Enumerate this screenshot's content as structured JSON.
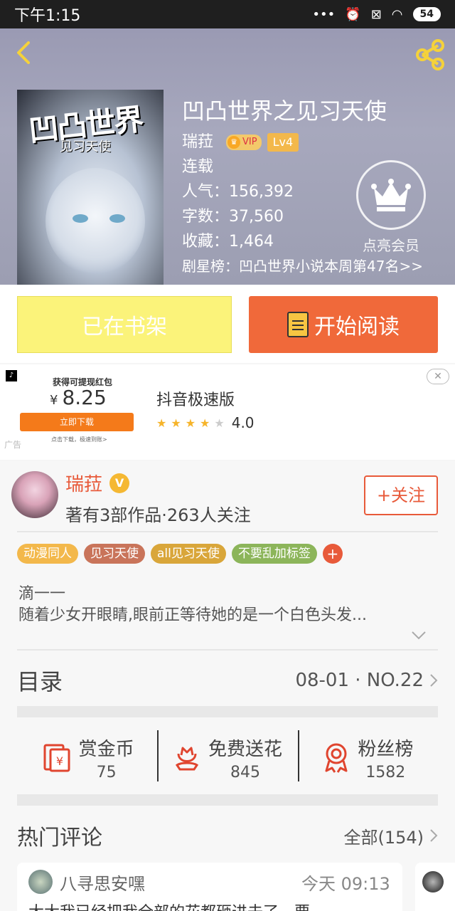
{
  "status_bar": {
    "time": "下午1:15",
    "battery": "54"
  },
  "book": {
    "title": "凹凸世界之见习天使",
    "cover_title": "凹凸世界",
    "cover_subtitle": "见习天使",
    "author": "瑞菈",
    "vip_label": "VIP",
    "level": "Lv4",
    "status": "连载",
    "popularity": "人气：156,392",
    "word_count": "字数：37,560",
    "favorites": "收藏：1,464",
    "rank": "剧星榜：凹凸世界小说本周第47名>>",
    "member_label": "点亮会员"
  },
  "actions": {
    "shelf_label": "已在书架",
    "read_label": "开始阅读"
  },
  "ad": {
    "logo": "♪",
    "redpacket_title": "获得可提现红包",
    "currency": "¥",
    "amount": "8.25",
    "download_label": "立即下载",
    "download_note": "点击下载，极速到账>",
    "ad_tag": "广告",
    "app_name": "抖音极速版",
    "rating": "4.0",
    "close": "✕"
  },
  "author_panel": {
    "name": "瑞菈",
    "badge": "V",
    "meta": "著有3部作品·263人关注",
    "follow_label": "+关注"
  },
  "tags": [
    {
      "label": "动漫同人",
      "color": "#f3b84b"
    },
    {
      "label": "见习天使",
      "color": "#c9745a"
    },
    {
      "label": "all见习天使",
      "color": "#d9a63a"
    },
    {
      "label": "不要乱加标签",
      "color": "#8cb55a"
    }
  ],
  "tag_add": "+",
  "synopsis": {
    "line1": "滴一一",
    "line2": "随着少女开眼睛,眼前正等待她的是一个白色头发..."
  },
  "catalog": {
    "title": "目录",
    "info": "08-01 · NO.22"
  },
  "stats": [
    {
      "label": "赏金币",
      "value": "75",
      "icon": "red-envelope-icon"
    },
    {
      "label": "免费送花",
      "value": "845",
      "icon": "flower-icon"
    },
    {
      "label": "粉丝榜",
      "value": "1582",
      "icon": "medal-icon"
    }
  ],
  "comments": {
    "title": "热门评论",
    "all_label": "全部(154)",
    "items": [
      {
        "name": "八寻思安嘿",
        "time": "今天 09:13",
        "text": "大大我已经把我全部的花都砸进去了，要"
      }
    ]
  },
  "colors": {
    "accent": "#e85a3a",
    "read_button": "#f0693a",
    "shelf_button": "#fbf37a"
  }
}
